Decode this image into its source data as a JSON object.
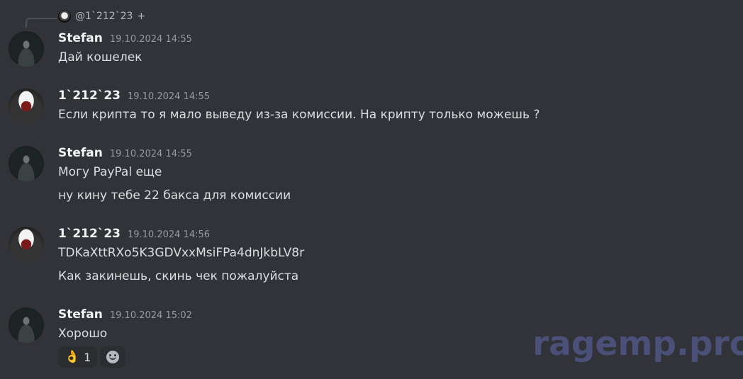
{
  "reply": {
    "mention": "@1`212`23",
    "plus": "+"
  },
  "messages": [
    {
      "username": "Stefan",
      "timestamp": "19.10.2024 14:55",
      "lines": [
        "Дай кошелек"
      ]
    },
    {
      "username": "1`212`23",
      "timestamp": "19.10.2024 14:55",
      "lines": [
        "Если крипта то я мало выведу из-за комиссии. На крипту только можешь ?"
      ]
    },
    {
      "username": "Stefan",
      "timestamp": "19.10.2024 14:55",
      "lines": [
        "Могу PayPal еще",
        "ну кину тебе 22 бакса для комиссии"
      ]
    },
    {
      "username": "1`212`23",
      "timestamp": "19.10.2024 14:56",
      "lines": [
        "TDKaXttRXo5K3GDVxxMsiFPa4dnJkbLV8r",
        "Как закинешь, скинь чек пожалуйста"
      ]
    },
    {
      "username": "Stefan",
      "timestamp": "19.10.2024 15:02",
      "lines": [
        "Хорошо"
      ]
    }
  ],
  "reactions": [
    {
      "emoji": "👌",
      "icon": "ok-hand-icon",
      "count": "1"
    }
  ],
  "add_reaction": {
    "icon": "add-reaction-smile-icon"
  },
  "watermark": "ragemp.pro"
}
